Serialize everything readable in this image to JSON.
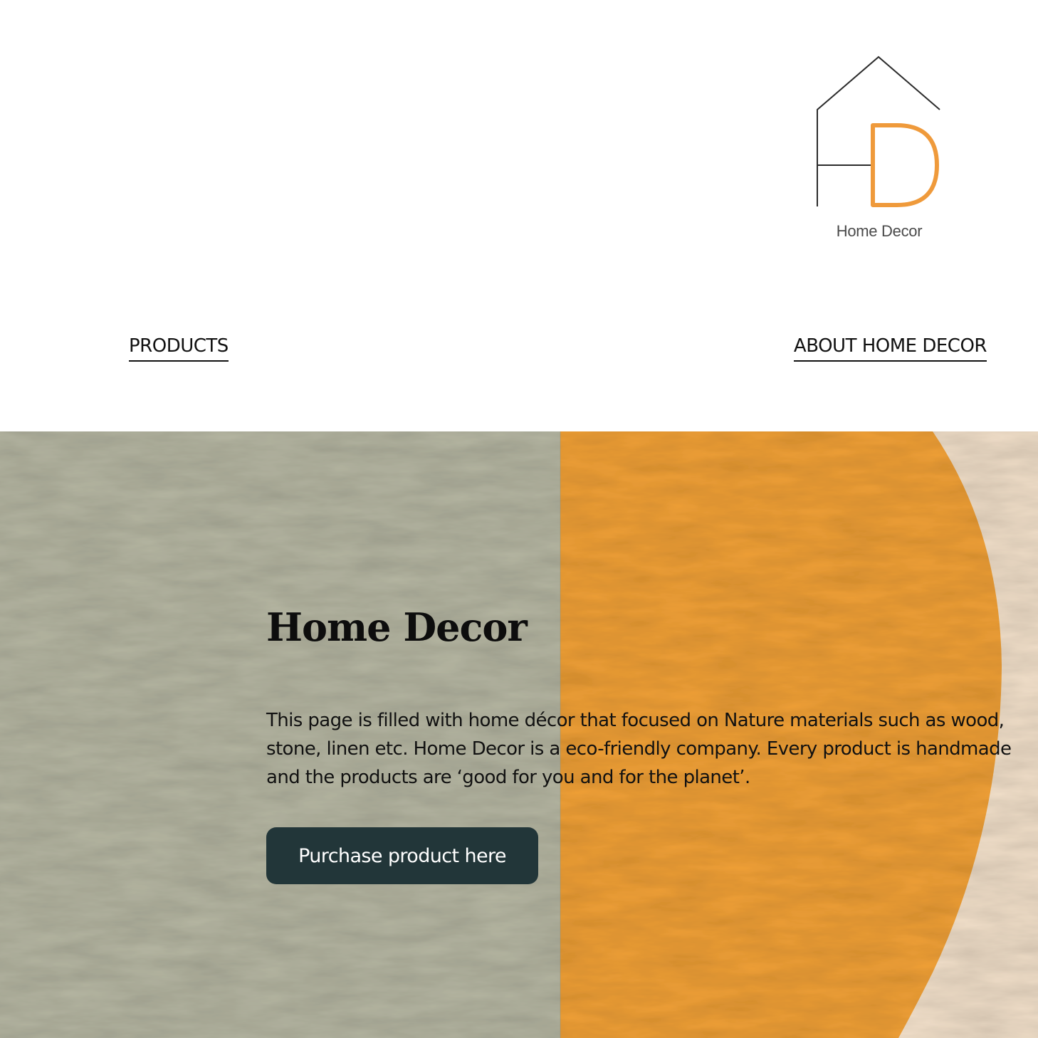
{
  "header": {
    "logo": {
      "text": "Home Decor",
      "accent_color": "#ef9a3b",
      "line_color": "#2b2b2b"
    }
  },
  "nav": {
    "products_label": "PRODUCTS",
    "about_label": "ABOUT HOME DECOR"
  },
  "hero": {
    "title": "Home Decor",
    "description": "This page is filled with home décor that focused on Nature materials such as wood, stone, linen etc. Home Decor is a eco-friendly company. Every product is handmade and the products are ‘good for you and for the planet’.",
    "cta_label": "Purchase product here",
    "colors": {
      "sage_panel": "#b5b6a2",
      "orange_circle": "#f0a037",
      "cream_background": "#f1dfc9",
      "button": "#223639"
    }
  }
}
